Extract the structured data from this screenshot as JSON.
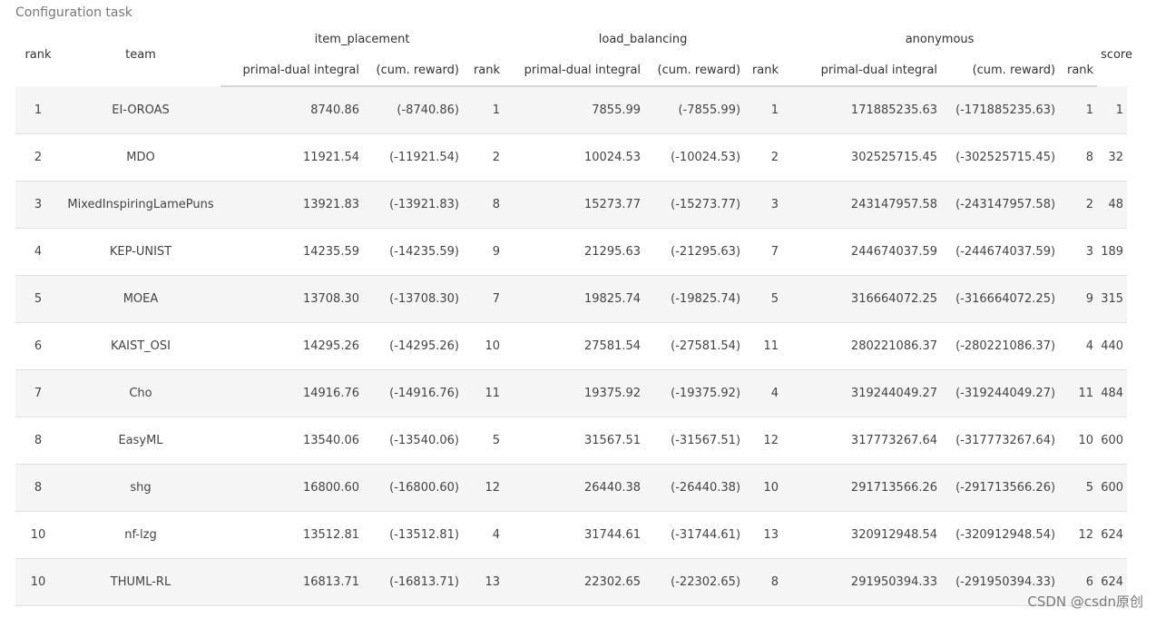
{
  "caption": "Configuration task",
  "header": {
    "rank": "rank",
    "team": "team",
    "groups": [
      "item_placement",
      "load_balancing",
      "anonymous"
    ],
    "sub": [
      "primal-dual integral",
      "(cum. reward)",
      "rank"
    ],
    "score": "score"
  },
  "rows": [
    {
      "rank": "1",
      "team": "EI-OROAS",
      "ip": "8740.86",
      "ip_cum": "(-8740.86)",
      "ip_rank": "1",
      "lb": "7855.99",
      "lb_cum": "(-7855.99)",
      "lb_rank": "1",
      "an": "171885235.63",
      "an_cum": "(-171885235.63)",
      "an_rank": "1",
      "score": "1"
    },
    {
      "rank": "2",
      "team": "MDO",
      "ip": "11921.54",
      "ip_cum": "(-11921.54)",
      "ip_rank": "2",
      "lb": "10024.53",
      "lb_cum": "(-10024.53)",
      "lb_rank": "2",
      "an": "302525715.45",
      "an_cum": "(-302525715.45)",
      "an_rank": "8",
      "score": "32"
    },
    {
      "rank": "3",
      "team": "MixedInspiringLamePuns",
      "ip": "13921.83",
      "ip_cum": "(-13921.83)",
      "ip_rank": "8",
      "lb": "15273.77",
      "lb_cum": "(-15273.77)",
      "lb_rank": "3",
      "an": "243147957.58",
      "an_cum": "(-243147957.58)",
      "an_rank": "2",
      "score": "48"
    },
    {
      "rank": "4",
      "team": "KEP-UNIST",
      "ip": "14235.59",
      "ip_cum": "(-14235.59)",
      "ip_rank": "9",
      "lb": "21295.63",
      "lb_cum": "(-21295.63)",
      "lb_rank": "7",
      "an": "244674037.59",
      "an_cum": "(-244674037.59)",
      "an_rank": "3",
      "score": "189"
    },
    {
      "rank": "5",
      "team": "MOEA",
      "ip": "13708.30",
      "ip_cum": "(-13708.30)",
      "ip_rank": "7",
      "lb": "19825.74",
      "lb_cum": "(-19825.74)",
      "lb_rank": "5",
      "an": "316664072.25",
      "an_cum": "(-316664072.25)",
      "an_rank": "9",
      "score": "315"
    },
    {
      "rank": "6",
      "team": "KAIST_OSI",
      "ip": "14295.26",
      "ip_cum": "(-14295.26)",
      "ip_rank": "10",
      "lb": "27581.54",
      "lb_cum": "(-27581.54)",
      "lb_rank": "11",
      "an": "280221086.37",
      "an_cum": "(-280221086.37)",
      "an_rank": "4",
      "score": "440"
    },
    {
      "rank": "7",
      "team": "Cho",
      "ip": "14916.76",
      "ip_cum": "(-14916.76)",
      "ip_rank": "11",
      "lb": "19375.92",
      "lb_cum": "(-19375.92)",
      "lb_rank": "4",
      "an": "319244049.27",
      "an_cum": "(-319244049.27)",
      "an_rank": "11",
      "score": "484"
    },
    {
      "rank": "8",
      "team": "EasyML",
      "ip": "13540.06",
      "ip_cum": "(-13540.06)",
      "ip_rank": "5",
      "lb": "31567.51",
      "lb_cum": "(-31567.51)",
      "lb_rank": "12",
      "an": "317773267.64",
      "an_cum": "(-317773267.64)",
      "an_rank": "10",
      "score": "600"
    },
    {
      "rank": "8",
      "team": "shg",
      "ip": "16800.60",
      "ip_cum": "(-16800.60)",
      "ip_rank": "12",
      "lb": "26440.38",
      "lb_cum": "(-26440.38)",
      "lb_rank": "10",
      "an": "291713566.26",
      "an_cum": "(-291713566.26)",
      "an_rank": "5",
      "score": "600"
    },
    {
      "rank": "10",
      "team": "nf-lzg",
      "ip": "13512.81",
      "ip_cum": "(-13512.81)",
      "ip_rank": "4",
      "lb": "31744.61",
      "lb_cum": "(-31744.61)",
      "lb_rank": "13",
      "an": "320912948.54",
      "an_cum": "(-320912948.54)",
      "an_rank": "12",
      "score": "624"
    },
    {
      "rank": "10",
      "team": "THUML-RL",
      "ip": "16813.71",
      "ip_cum": "(-16813.71)",
      "ip_rank": "13",
      "lb": "22302.65",
      "lb_cum": "(-22302.65)",
      "lb_rank": "8",
      "an": "291950394.33",
      "an_cum": "(-291950394.33)",
      "an_rank": "6",
      "score": "624"
    }
  ],
  "watermark": "CSDN @csdn原创"
}
